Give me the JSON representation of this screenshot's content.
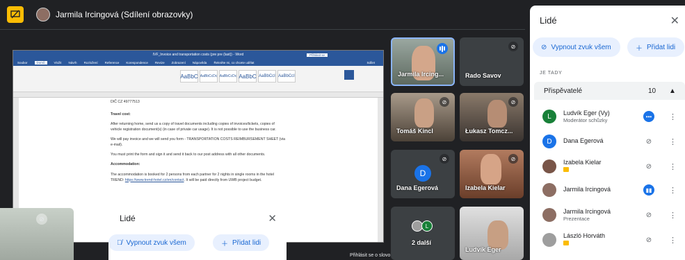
{
  "header": {
    "presenter": "Jarmila Ircingová (Sdílení obrazovky)"
  },
  "document": {
    "window_title": "IVF_Invoice and transportation costs (pre pre (last)) - Word",
    "signin": "Přihlásit se",
    "tabs": [
      "Soubor",
      "Domů",
      "Vložit",
      "Návrh",
      "Rozložení",
      "Reference",
      "Korespondence",
      "Revize",
      "Zobrazení",
      "Nápověda",
      "Řekněte mi, co chcete udělat"
    ],
    "share_label": "Sdílet",
    "tax_id": "DIČ CZ 49777513",
    "travel_heading": "Travel cost:",
    "p1": "After returning home, send us a copy of travel documents including copies of invoices/tickets, copies of vehicle registration document(s) (in case of private car usage). It is not possible to use the business car.",
    "p2": "We will pay invoice and we will send you form - TRANSPORTATION COSTS REIMBURSEMENT SHEET (via e-mail).",
    "p3": "You must print the form and sign it and send it back to our post address with all other documents.",
    "acc_heading": "Accommodation:",
    "p4a": "The accommodation is booked for 2 persons from each partner for 2 nights in single rooms in the hotel TREND: ",
    "p4link": "https://www.trend-hotel.cz/en/contact",
    "p4b": ". It will be paid directly from UWB project budget.",
    "styles": [
      "AaBbC",
      "AaBbCcDc",
      "AaBbCcDc",
      "AaBbC",
      "AaBbCcI",
      "AaBbCcI"
    ]
  },
  "tiles": [
    {
      "name": "Jarmila Ircing..."
    },
    {
      "name": "Rado Savov"
    },
    {
      "name": "Tomáš Kincl"
    },
    {
      "name": "Łukasz Tomcz..."
    },
    {
      "name": "Dana Egerová",
      "initial": "D"
    },
    {
      "name": "Izabela Kielar"
    },
    {
      "name": "2 další"
    },
    {
      "name": "Ludvík Eger"
    }
  ],
  "people_panel": {
    "title": "Lidé",
    "mute_all": "Vypnout zvuk všem",
    "add_people": "Přidat lidi",
    "section": "JE TADY",
    "category": "Přispěvatelé",
    "count": "10",
    "rows": [
      {
        "name": "Ludvík Eger (Vy)",
        "sub": "Moderátor schůzky",
        "initial": "L",
        "color": "#188038"
      },
      {
        "name": "Dana Egerová",
        "sub": "",
        "initial": "D",
        "color": "#1a73e8"
      },
      {
        "name": "Izabela Kielar",
        "sub": "",
        "initial": "",
        "color": "#795548"
      },
      {
        "name": "Jarmila Ircingová",
        "sub": "",
        "initial": "",
        "color": "#8d6e63"
      },
      {
        "name": "Jarmila Ircingová",
        "sub": "Prezentace",
        "initial": "",
        "color": "#8d6e63"
      },
      {
        "name": "László Horváth",
        "sub": "",
        "initial": "",
        "color": "#9e9e9e"
      }
    ]
  },
  "overlay_panel": {
    "title": "Lidé",
    "mute_all": "Vypnout zvuk všem",
    "add_people": "Přidat lidi"
  },
  "tooltip": "Přihlásit se o slovo"
}
